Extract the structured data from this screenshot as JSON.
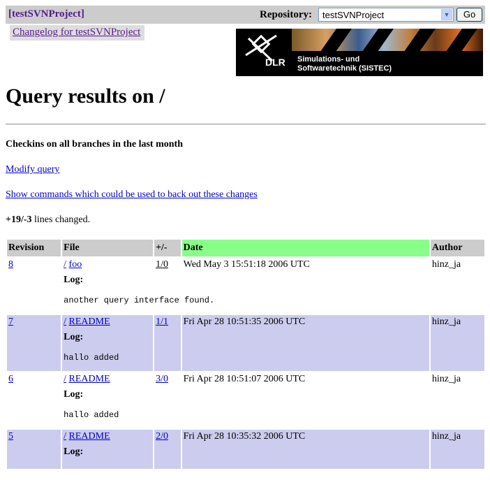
{
  "header": {
    "project_link": "[testSVNProject]",
    "repository_label": "Repository:",
    "repository_selected": "testSVNProject",
    "go_label": "Go",
    "changelog_link": "Changelog for testSVNProject"
  },
  "logo": {
    "org": "DLR",
    "line1": "Simulations- und",
    "line2": "Softwaretechnik (SISTEC)"
  },
  "page": {
    "title": "Query results on /",
    "subtitle": "Checkins on all branches in the last month",
    "modify_link": "Modify query",
    "backout_link": "Show commands which could be used to back out these changes",
    "lines_changed_count": "+19/-3",
    "lines_changed_suffix": " lines changed."
  },
  "table": {
    "headers": {
      "revision": "Revision",
      "file": "File",
      "plusminus": "+/-",
      "date": "Date",
      "author": "Author"
    },
    "log_label": "Log:",
    "rows": [
      {
        "revision": "8",
        "file_dir": "/",
        "file_name": "foo",
        "plusminus": "1/0",
        "date": "Wed May 3 15:51:18 2006 UTC",
        "author": "hinz_ja",
        "log": "another query interface found."
      },
      {
        "revision": "7",
        "file_dir": "/",
        "file_name": "README",
        "plusminus": "1/1",
        "date": "Fri Apr 28 10:51:35 2006 UTC",
        "author": "hinz_ja",
        "log": "hallo added"
      },
      {
        "revision": "6",
        "file_dir": "/",
        "file_name": "README",
        "plusminus": "3/0",
        "date": "Fri Apr 28 10:51:07 2006 UTC",
        "author": "hinz_ja",
        "log": "hallo added"
      },
      {
        "revision": "5",
        "file_dir": "/",
        "file_name": "README",
        "plusminus": "2/0",
        "date": "Fri Apr 28 10:35:32 2006 UTC",
        "author": "hinz_ja",
        "log": ""
      }
    ]
  }
}
